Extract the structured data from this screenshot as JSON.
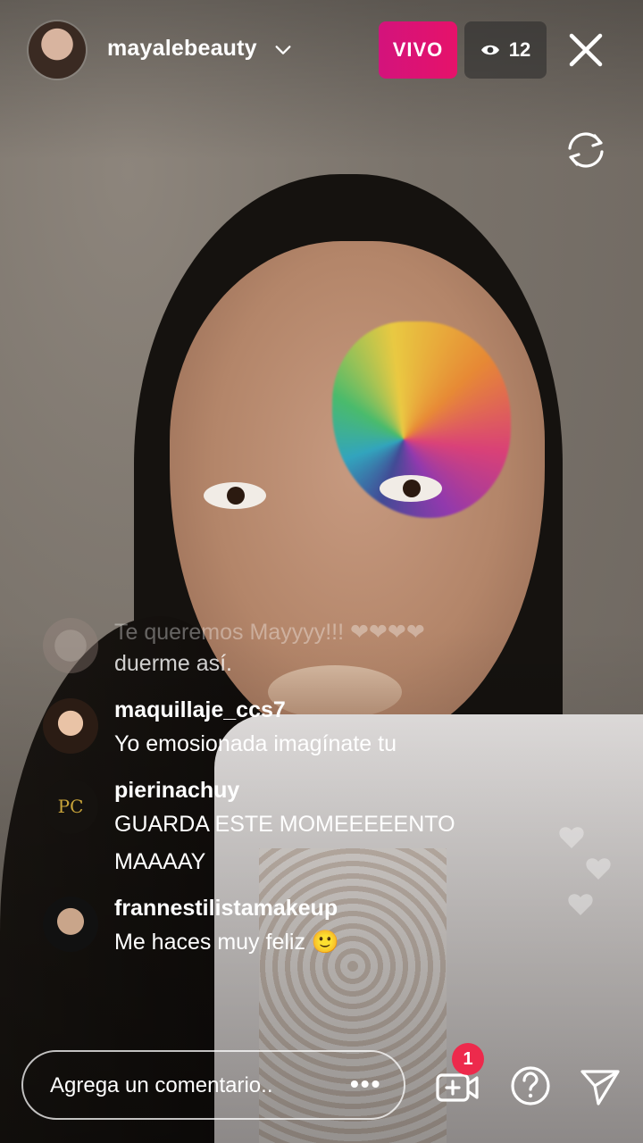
{
  "header": {
    "username": "mayalebeauty",
    "live_label": "VIVO",
    "viewer_count": "12",
    "icons": [
      "chevron-down-icon",
      "eye-icon",
      "close-icon",
      "switch-camera-icon"
    ]
  },
  "comments": [
    {
      "user": "",
      "text": "Te queremos Mayyyy!!! ❤❤❤❤"
    },
    {
      "user": "",
      "text": "duerme así."
    },
    {
      "user": "maquillaje_ccs7",
      "text": "Yo emosionada imagínate tu"
    },
    {
      "user": "pierinachuy",
      "text": "GUARDA ESTE MOMEEEEENTO MAAAAY"
    },
    {
      "user": "frannestilistamakeup",
      "text": "Me haces muy feliz 🙂"
    }
  ],
  "bottom_bar": {
    "comment_placeholder": "Agrega un comentario..",
    "more_label": "•••",
    "invite_badge_count": "1",
    "icons": [
      "add-guest-icon",
      "question-icon",
      "send-icon"
    ]
  },
  "colors": {
    "live_badge": "#d3137c",
    "notification_badge": "#ed2a4c"
  }
}
